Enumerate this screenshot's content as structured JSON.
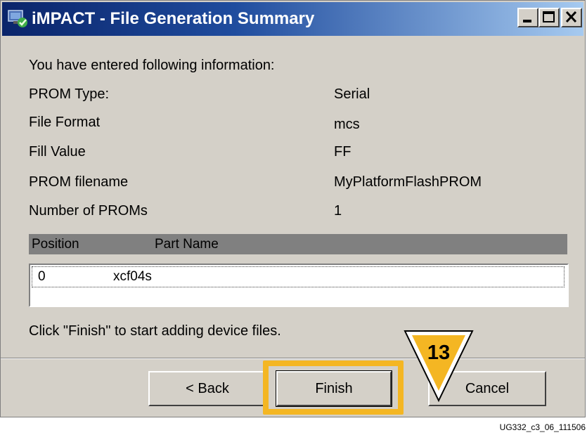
{
  "window": {
    "title": "iMPACT - File Generation Summary"
  },
  "content": {
    "intro": "You have entered following information:",
    "fields": [
      {
        "label": "PROM Type:",
        "value": "Serial"
      },
      {
        "label": "File Format",
        "value": "mcs"
      },
      {
        "label": "Fill Value",
        "value": "FF"
      },
      {
        "label": "PROM filename",
        "value": "MyPlatformFlashPROM"
      },
      {
        "label": "Number of PROMs",
        "value": "1"
      }
    ],
    "table": {
      "headers": [
        "Position",
        "Part Name"
      ],
      "rows": [
        {
          "position": "0",
          "part_name": "xcf04s"
        }
      ]
    },
    "instruction": "Click \"Finish\" to start adding device files."
  },
  "buttons": {
    "back": "< Back",
    "finish": "Finish",
    "cancel": "Cancel"
  },
  "annotation": {
    "step": "13",
    "highlight_color": "#f4b623"
  },
  "figure_id": "UG332_c3_06_111506",
  "icons": [
    "impact-app-icon",
    "minimize-icon",
    "maximize-icon",
    "close-icon"
  ]
}
